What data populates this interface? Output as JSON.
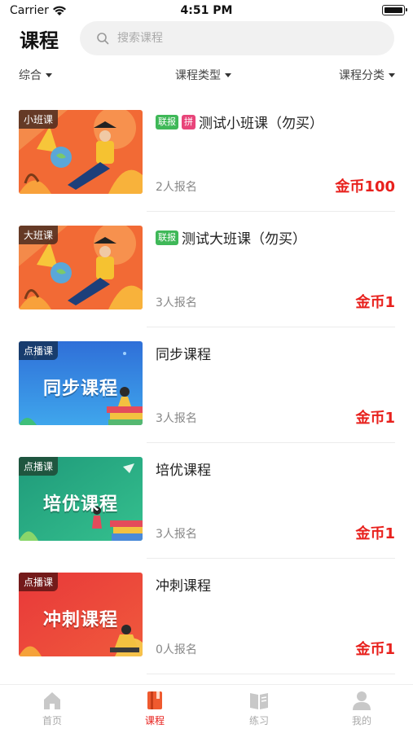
{
  "status": {
    "carrier": "Carrier",
    "time": "4:51 PM"
  },
  "header": {
    "title": "课程",
    "search_placeholder": "搜索课程"
  },
  "filters": [
    {
      "label": "综合"
    },
    {
      "label": "课程类型"
    },
    {
      "label": "课程分类"
    }
  ],
  "courses": [
    {
      "tag": "小班课",
      "thumb_text": "",
      "badges": [
        "联报",
        "拼"
      ],
      "title": "测试小班课（勿买）",
      "enroll": "2人报名",
      "price": "金币100"
    },
    {
      "tag": "大班课",
      "thumb_text": "",
      "badges": [
        "联报"
      ],
      "title": "测试大班课（勿买）",
      "enroll": "3人报名",
      "price": "金币1"
    },
    {
      "tag": "点播课",
      "thumb_text": "同步课程",
      "badges": [],
      "title": "同步课程",
      "enroll": "3人报名",
      "price": "金币1"
    },
    {
      "tag": "点播课",
      "thumb_text": "培优课程",
      "badges": [],
      "title": "培优课程",
      "enroll": "3人报名",
      "price": "金币1"
    },
    {
      "tag": "点播课",
      "thumb_text": "冲刺课程",
      "badges": [],
      "title": "冲刺课程",
      "enroll": "0人报名",
      "price": "金币1"
    }
  ],
  "tabbar": [
    {
      "label": "首页",
      "icon": "home-icon"
    },
    {
      "label": "课程",
      "icon": "course-book-icon"
    },
    {
      "label": "练习",
      "icon": "practice-book-icon"
    },
    {
      "label": "我的",
      "icon": "user-icon"
    }
  ],
  "colors": {
    "accent": "#e8211d",
    "badge_green": "#3fb858",
    "badge_pink": "#e8457a"
  }
}
